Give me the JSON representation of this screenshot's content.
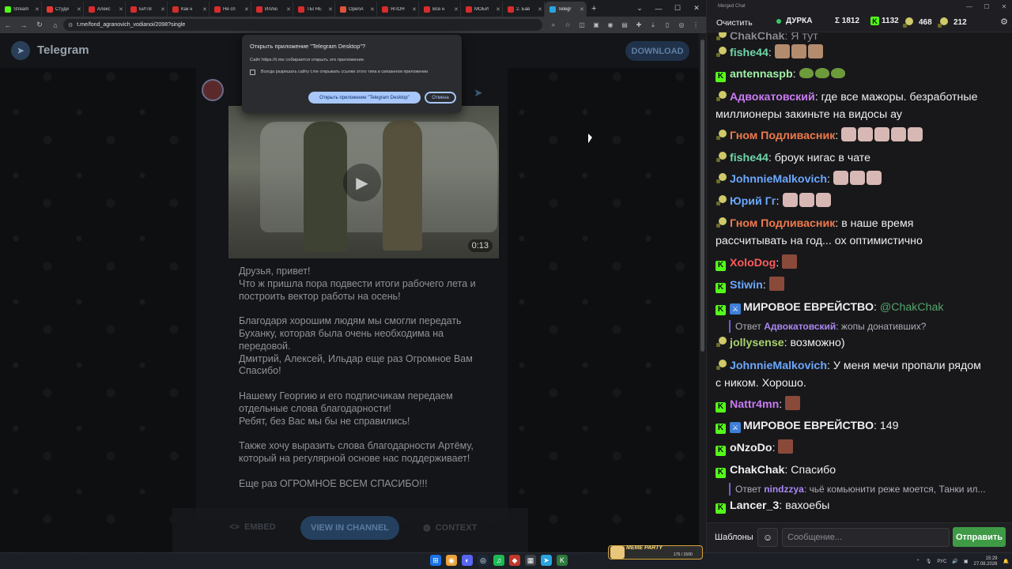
{
  "browser": {
    "tabs": [
      {
        "label": "Stream",
        "color": "#53fc18",
        "active": false
      },
      {
        "label": "Студи",
        "color": "#e53935",
        "active": false
      },
      {
        "label": "Алекс",
        "color": "#d62c2c",
        "active": false
      },
      {
        "label": "БИТВ",
        "color": "#d62c2c",
        "active": false
      },
      {
        "label": "Как н",
        "color": "#d62c2c",
        "active": false
      },
      {
        "label": "Не сп",
        "color": "#d62c2c",
        "active": false
      },
      {
        "label": "Иллю",
        "color": "#d62c2c",
        "active": false
      },
      {
        "label": "ТЫ НЕ",
        "color": "#d62c2c",
        "active": false
      },
      {
        "label": "OpenA",
        "color": "#e0533b",
        "active": false
      },
      {
        "label": "ЯПОН",
        "color": "#d62c2c",
        "active": false
      },
      {
        "label": "Все н",
        "color": "#d62c2c",
        "active": false
      },
      {
        "label": "МОБИ",
        "color": "#d62c2c",
        "active": false
      },
      {
        "label": "2. Бав",
        "color": "#d62c2c",
        "active": false
      },
      {
        "label": "Telegr",
        "color": "#2aa3df",
        "active": true
      }
    ],
    "url": "t.me/fond_agranovich_vodianoi/2098?single"
  },
  "telegram": {
    "title": "Telegram",
    "download_label": "DOWNLOAD",
    "video_duration": "0:13",
    "post_lines": [
      [
        "Друзья, привет!",
        "Что ж пришла пора подвести итоги рабочего лета и",
        "построить вектор работы на осень!"
      ],
      [
        "Благодаря хорошим людям мы смогли передать",
        "Буханку, которая была очень необходима на",
        "передовой.",
        "Дмитрий, Алексей, Ильдар еще раз Огромное Вам",
        "Спасибо!"
      ],
      [
        "Нашему Георгию и его подписчикам передаем",
        "отдельные слова благодарности!",
        "Ребят, без Вас мы бы не справились!"
      ],
      [
        "Также хочу выразить слова благодарности Артёму,",
        "который на регулярной основе нас поддерживает!"
      ],
      [
        "Еще раз ОГРОМНОЕ ВСЕМ СПАСИБО!!!"
      ]
    ],
    "embed_label": "EMBED",
    "view_label": "VIEW IN CHANNEL",
    "context_label": "CONTEXT"
  },
  "dialog": {
    "title": "Открыть приложение \"Telegram Desktop\"?",
    "subtitle": "Сайт https://t.me собирается открыть это приложение.",
    "checkbox_label": "Всегда разрешать сайту t.me открывать ссылки этого типа в связанном приложении",
    "open_label": "Открыть приложение \"Telegram Desktop\"",
    "cancel_label": "Отмена"
  },
  "chat": {
    "window_title": "Merged Chat",
    "clear_label": "Очистить",
    "stream_name": "ДУРКА",
    "total": "Σ 1812",
    "kick_count": "1132",
    "yt_count": "468",
    "other_count": "212",
    "messages": [
      {
        "platform": "y",
        "user": "fishe44",
        "color": "#6fd6a8",
        "text": "",
        "emotes": [
          "cookie",
          "cookie",
          "cookie"
        ]
      },
      {
        "platform": "k",
        "user": "antennaspb",
        "color": "#9ef2a4",
        "text": "",
        "emotes": [
          "frog",
          "frog",
          "frog"
        ]
      },
      {
        "platform": "y",
        "user": "Адвокатовский",
        "color": "#c97bf2",
        "text": "где все мажоры. безработные",
        "text2": "миллионеры закиньте на видосы ау"
      },
      {
        "platform": "y",
        "user": "Гном Подливасник",
        "color": "#f07a4a",
        "text": "",
        "emotes": [
          "face",
          "face",
          "face",
          "face",
          "face"
        ]
      },
      {
        "platform": "y",
        "user": "fishe44",
        "color": "#6fd6a8",
        "text": "броук нигас в чате"
      },
      {
        "platform": "y",
        "user": "JohnnieMalkovich",
        "color": "#6aa8ff",
        "text": "",
        "emotes": [
          "face",
          "face",
          "face"
        ]
      },
      {
        "platform": "y",
        "user": "Юрий Гг",
        "color": "#6aa8ff",
        "text": "",
        "emotes": [
          "face",
          "face",
          "face"
        ]
      },
      {
        "platform": "y",
        "user": "Гном Подливасник",
        "color": "#f07a4a",
        "text": "в наше время",
        "text2": "рассчитывать на год... ох оптимистично"
      },
      {
        "platform": "k",
        "user": "XoloDog",
        "color": "#ff5a5a",
        "text": "",
        "emotes": [
          "dark"
        ]
      },
      {
        "platform": "k",
        "user": "Stiwin",
        "color": "#6aa8ff",
        "text": "",
        "emotes": [
          "dark"
        ]
      },
      {
        "platform": "km",
        "user": "МИРОВОЕ ЕВРЕЙСТВО",
        "color": "#efeff1",
        "text": "@ChakChak",
        "mention": true
      },
      {
        "platform": "y",
        "user": "jollysense",
        "color": "#a7d16a",
        "text": "возможно)"
      },
      {
        "platform": "y",
        "user": "JohnnieMalkovich",
        "color": "#6aa8ff",
        "text": "У меня мечи пропали рядом",
        "text2": "с ником. Хорошо."
      },
      {
        "platform": "k",
        "user": "Nattr4mn",
        "color": "#c97bf2",
        "text": "",
        "emotes": [
          "dark"
        ]
      },
      {
        "platform": "km",
        "user": "МИРОВОЕ ЕВРЕЙСТВО",
        "color": "#efeff1",
        "text": "149"
      },
      {
        "platform": "k",
        "user": "oNzoDo",
        "color": "#efeff1",
        "text": "",
        "emotes": [
          "dark"
        ]
      },
      {
        "platform": "k",
        "user": "ChakChak",
        "color": "#efeff1",
        "text": "Спасибо"
      },
      {
        "platform": "k",
        "user": "Lancer_3",
        "color": "#efeff1",
        "text": "вахоебы"
      }
    ],
    "reply1": {
      "prefix": "Ответ",
      "user": "Адвокатовский",
      "text": ": жопы донативших?"
    },
    "reply2": {
      "prefix": "Ответ",
      "user": "nindzzya",
      "text": ": чьё комьюнити реже моется, Танки ил..."
    },
    "templates_label": "Шаблоны",
    "input_placeholder": "Сообщение...",
    "send_label": "Отправить"
  },
  "taskbar": {
    "overlay_title": "MEME PARTY",
    "overlay_count": "175 / 1500",
    "lang": "РУС",
    "time": "15:29",
    "date": "27.08.2026"
  }
}
